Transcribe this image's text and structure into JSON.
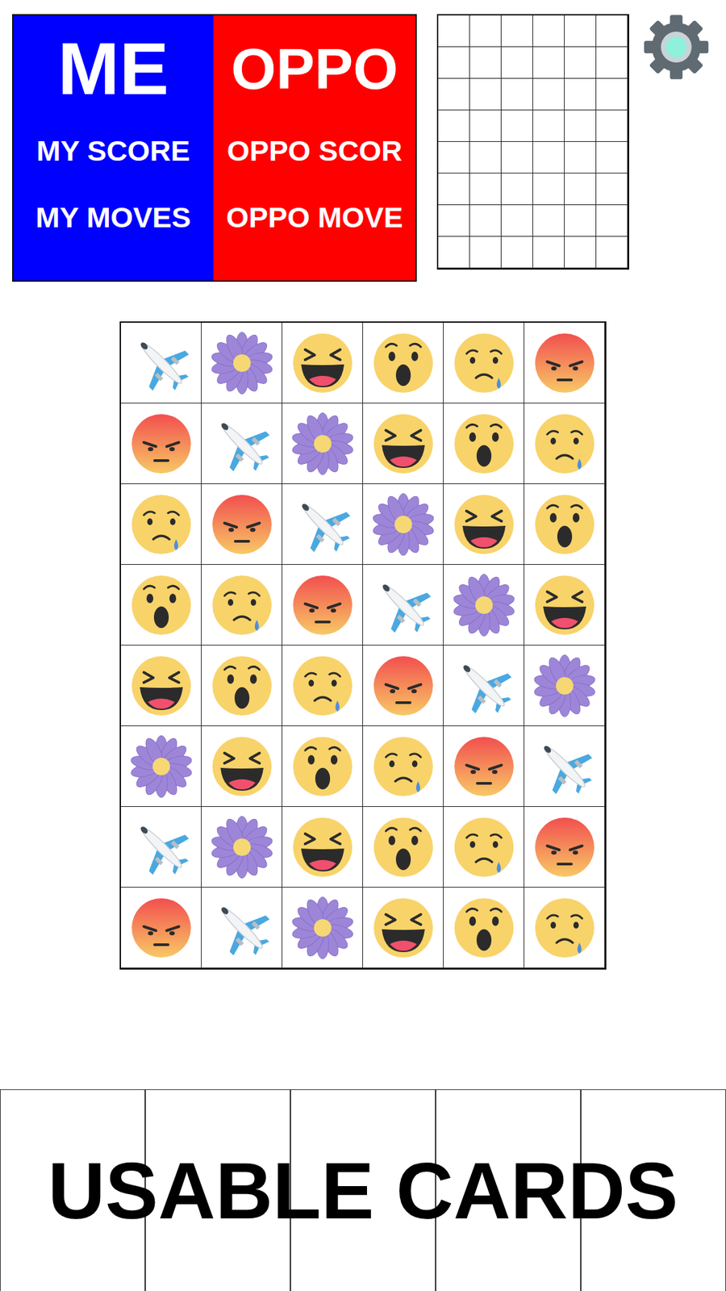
{
  "players": [
    {
      "name": "ME",
      "score_label": "MY SCORE",
      "moves_label": "MY MOVES",
      "color": "#0000ff"
    },
    {
      "name": "OPPO",
      "score_label": "OPPO SCOR",
      "moves_label": "OPPO MOVE",
      "color": "#ff0000"
    }
  ],
  "tracker": {
    "rows": [
      [
        {
          "filled": false
        },
        {
          "filled": false
        },
        {
          "filled": false
        },
        {
          "filled": false
        },
        {
          "filled": false
        },
        {
          "filled": false
        }
      ],
      [
        {
          "filled": false
        },
        {
          "filled": false
        },
        {
          "filled": false
        },
        {
          "filled": false
        },
        {
          "filled": false
        },
        {
          "filled": false
        }
      ],
      [
        {
          "filled": false
        },
        {
          "filled": false
        },
        {
          "filled": false
        },
        {
          "filled": false
        },
        {
          "filled": false
        },
        {
          "filled": false
        }
      ],
      [
        {
          "filled": false
        },
        {
          "filled": false
        },
        {
          "filled": false
        },
        {
          "filled": false
        },
        {
          "filled": false
        },
        {
          "filled": false
        }
      ],
      [
        {
          "filled": false
        },
        {
          "filled": false
        },
        {
          "filled": false
        },
        {
          "filled": false
        },
        {
          "filled": false
        },
        {
          "filled": false
        }
      ],
      [
        {
          "filled": false
        },
        {
          "filled": false
        },
        {
          "filled": false
        },
        {
          "filled": false
        },
        {
          "filled": false
        },
        {
          "filled": false
        }
      ],
      [
        {
          "filled": false
        },
        {
          "filled": false
        },
        {
          "filled": false
        },
        {
          "filled": false
        },
        {
          "filled": false
        },
        {
          "filled": false
        }
      ],
      [
        {
          "filled": false
        },
        {
          "filled": false
        },
        {
          "filled": false
        },
        {
          "filled": false
        },
        {
          "filled": false
        },
        {
          "filled": false
        }
      ]
    ]
  },
  "board": {
    "rows": [
      [
        {
          "kind": "plane"
        },
        {
          "kind": "flower"
        },
        {
          "kind": "laugh"
        },
        {
          "kind": "wow"
        },
        {
          "kind": "sad"
        },
        {
          "kind": "angry"
        }
      ],
      [
        {
          "kind": "angry"
        },
        {
          "kind": "plane"
        },
        {
          "kind": "flower"
        },
        {
          "kind": "laugh"
        },
        {
          "kind": "wow"
        },
        {
          "kind": "sad"
        }
      ],
      [
        {
          "kind": "sad"
        },
        {
          "kind": "angry"
        },
        {
          "kind": "plane"
        },
        {
          "kind": "flower"
        },
        {
          "kind": "laugh"
        },
        {
          "kind": "wow"
        }
      ],
      [
        {
          "kind": "wow"
        },
        {
          "kind": "sad"
        },
        {
          "kind": "angry"
        },
        {
          "kind": "plane"
        },
        {
          "kind": "flower"
        },
        {
          "kind": "laugh"
        }
      ],
      [
        {
          "kind": "laugh"
        },
        {
          "kind": "wow"
        },
        {
          "kind": "sad"
        },
        {
          "kind": "angry"
        },
        {
          "kind": "plane"
        },
        {
          "kind": "flower"
        }
      ],
      [
        {
          "kind": "flower"
        },
        {
          "kind": "laugh"
        },
        {
          "kind": "wow"
        },
        {
          "kind": "sad"
        },
        {
          "kind": "angry"
        },
        {
          "kind": "plane"
        }
      ],
      [
        {
          "kind": "plane"
        },
        {
          "kind": "flower"
        },
        {
          "kind": "laugh"
        },
        {
          "kind": "wow"
        },
        {
          "kind": "sad"
        },
        {
          "kind": "angry"
        }
      ],
      [
        {
          "kind": "angry"
        },
        {
          "kind": "plane"
        },
        {
          "kind": "flower"
        },
        {
          "kind": "laugh"
        },
        {
          "kind": "wow"
        },
        {
          "kind": "sad"
        }
      ]
    ]
  },
  "cards": {
    "label": "USABLE CARDS",
    "slots": [
      {
        "filled": false
      },
      {
        "filled": false
      },
      {
        "filled": false
      },
      {
        "filled": false
      },
      {
        "filled": false
      }
    ]
  }
}
